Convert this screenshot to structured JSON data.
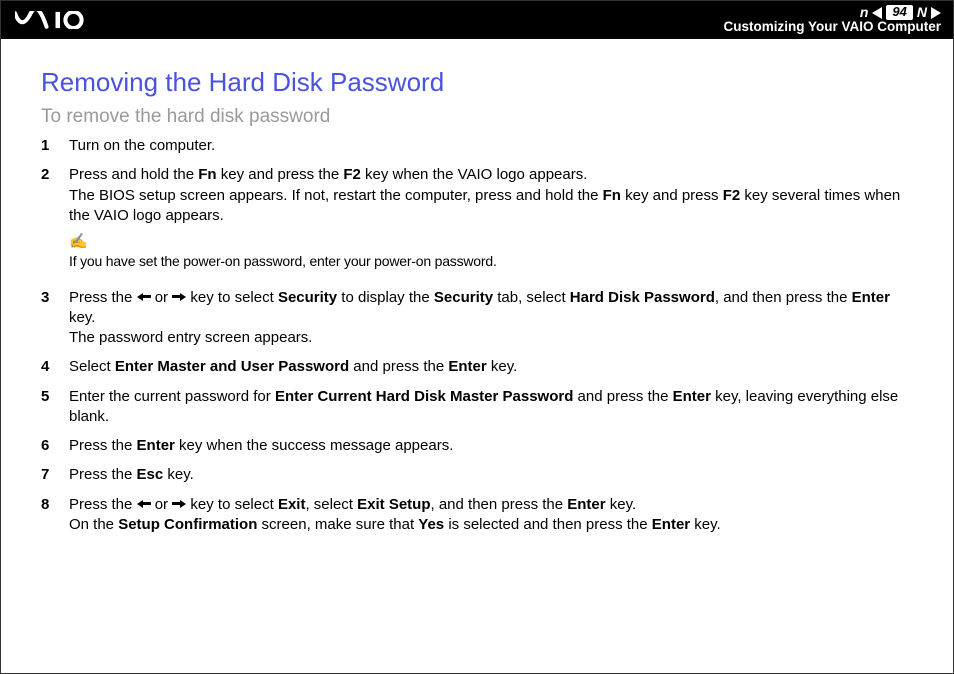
{
  "header": {
    "page_number": "94",
    "n_label": "n",
    "N_label": "N",
    "section": "Customizing Your VAIO Computer"
  },
  "title": "Removing the Hard Disk Password",
  "subtitle": "To remove the hard disk password",
  "steps": {
    "s1": {
      "num": "1",
      "text": "Turn on the computer."
    },
    "s2": {
      "num": "2",
      "p1a": "Press and hold the ",
      "p1b": "Fn",
      "p1c": " key and press the ",
      "p1d": "F2",
      "p1e": " key when the VAIO logo appears.",
      "p2a": "The BIOS setup screen appears. If not, restart the computer, press and hold the ",
      "p2b": "Fn",
      "p2c": " key and press ",
      "p2d": "F2",
      "p2e": " key several times when the VAIO logo appears.",
      "note": "If you have set the power-on password, enter your power-on password."
    },
    "s3": {
      "num": "3",
      "a": "Press the ",
      "b": " or ",
      "c": " key to select ",
      "d": "Security",
      "e": " to display the ",
      "f": "Security",
      "g": " tab, select ",
      "h": "Hard Disk Password",
      "i": ", and then press the ",
      "j": "Enter",
      "k": " key.",
      "l": "The password entry screen appears."
    },
    "s4": {
      "num": "4",
      "a": "Select ",
      "b": "Enter Master and User Password",
      "c": " and press the ",
      "d": "Enter",
      "e": " key."
    },
    "s5": {
      "num": "5",
      "a": "Enter the current password for ",
      "b": "Enter Current Hard Disk Master Password",
      "c": " and press the ",
      "d": "Enter",
      "e": " key, leaving everything else blank."
    },
    "s6": {
      "num": "6",
      "a": "Press the ",
      "b": "Enter",
      "c": " key when the success message appears."
    },
    "s7": {
      "num": "7",
      "a": "Press the ",
      "b": "Esc",
      "c": " key."
    },
    "s8": {
      "num": "8",
      "a": "Press the ",
      "b": " or ",
      "c": " key to select ",
      "d": "Exit",
      "e": ", select ",
      "f": "Exit Setup",
      "g": ", and then press the ",
      "h": "Enter",
      "i": " key.",
      "j": "On the ",
      "k": "Setup Confirmation",
      "l": " screen, make sure that ",
      "m": "Yes",
      "n": " is selected and then press the ",
      "o": "Enter",
      "p": " key."
    }
  }
}
